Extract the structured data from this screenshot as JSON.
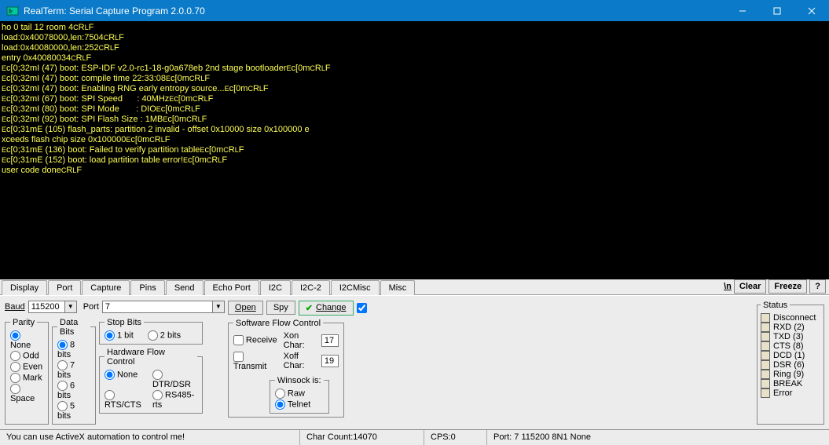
{
  "window": {
    "title": "RealTerm: Serial Capture Program 2.0.0.70"
  },
  "terminal_lines": [
    "ho 0 tail 12 room 4{CRLF}",
    "load:0x40078000,len:7504{CRLF}",
    "load:0x40080000,len:252{CRLF}",
    "entry 0x40080034{CRLF}",
    "{ESC}[0;32mI (47) boot: ESP-IDF v2.0-rc1-18-g0a678eb 2nd stage bootloader{ESC}[0m{CRLF}",
    "{ESC}[0;32mI (47) boot: compile time 22:33:08{ESC}[0m{CRLF}",
    "{ESC}[0;32mI (47) boot: Enabling RNG early entropy source...{ESC}[0m{CRLF}",
    "{ESC}[0;32mI (67) boot: SPI Speed      : 40MHz{ESC}[0m{CRLF}",
    "{ESC}[0;32mI (80) boot: SPI Mode       : DIO{ESC}[0m{CRLF}",
    "{ESC}[0;32mI (92) boot: SPI Flash Size : 1MB{ESC}[0m{CRLF}",
    "{ESC}[0;31mE (105) flash_parts: partition 2 invalid - offset 0x10000 size 0x100000 e",
    "xceeds flash chip size 0x100000{ESC}[0m{CRLF}",
    "{ESC}[0;31mE (136) boot: Failed to verify partition table{ESC}[0m{CRLF}",
    "{ESC}[0;31mE (152) boot: load partition table error!{ESC}[0m{CRLF}",
    "user code done{CRLF}"
  ],
  "tabs": {
    "items": [
      "Display",
      "Port",
      "Capture",
      "Pins",
      "Send",
      "Echo Port",
      "I2C",
      "I2C-2",
      "I2CMisc",
      "Misc"
    ],
    "active": "Port",
    "newline_label": "\\n",
    "clear_label": "Clear",
    "freeze_label": "Freeze",
    "help_label": "?"
  },
  "port_panel": {
    "baud_label": "Baud",
    "baud_value": "115200",
    "port_label": "Port",
    "port_value": "7",
    "open_label": "Open",
    "spy_label": "Spy",
    "change_label": "Change",
    "parity": {
      "legend": "Parity",
      "options": [
        "None",
        "Odd",
        "Even",
        "Mark",
        "Space"
      ],
      "selected": "None"
    },
    "databits": {
      "legend": "Data Bits",
      "options": [
        "8 bits",
        "7 bits",
        "6 bits",
        "5 bits"
      ],
      "selected": "8 bits"
    },
    "stopbits": {
      "legend": "Stop Bits",
      "options": [
        "1 bit",
        "2 bits"
      ],
      "selected": "1 bit"
    },
    "hwflow": {
      "legend": "Hardware Flow Control",
      "options": [
        "None",
        "DTR/DSR",
        "RTS/CTS",
        "RS485-rts"
      ],
      "selected": "None"
    },
    "swflow": {
      "legend": "Software Flow Control",
      "receive_label": "Receive",
      "transmit_label": "Transmit",
      "xon_label": "Xon Char:",
      "xoff_label": "Xoff Char:",
      "xon_value": "17",
      "xoff_value": "19"
    },
    "winsock": {
      "legend": "Winsock is:",
      "options": [
        "Raw",
        "Telnet"
      ],
      "selected": "Telnet"
    }
  },
  "status_panel": {
    "legend": "Status",
    "items": [
      "Disconnect",
      "RXD (2)",
      "TXD (3)",
      "CTS (8)",
      "DCD (1)",
      "DSR (6)",
      "Ring (9)",
      "BREAK",
      "Error"
    ]
  },
  "statusbar": {
    "hint": "You can use ActiveX automation to control me!",
    "charcount": "Char Count:14070",
    "cps": "CPS:0",
    "port": "Port: 7 115200 8N1 None"
  }
}
